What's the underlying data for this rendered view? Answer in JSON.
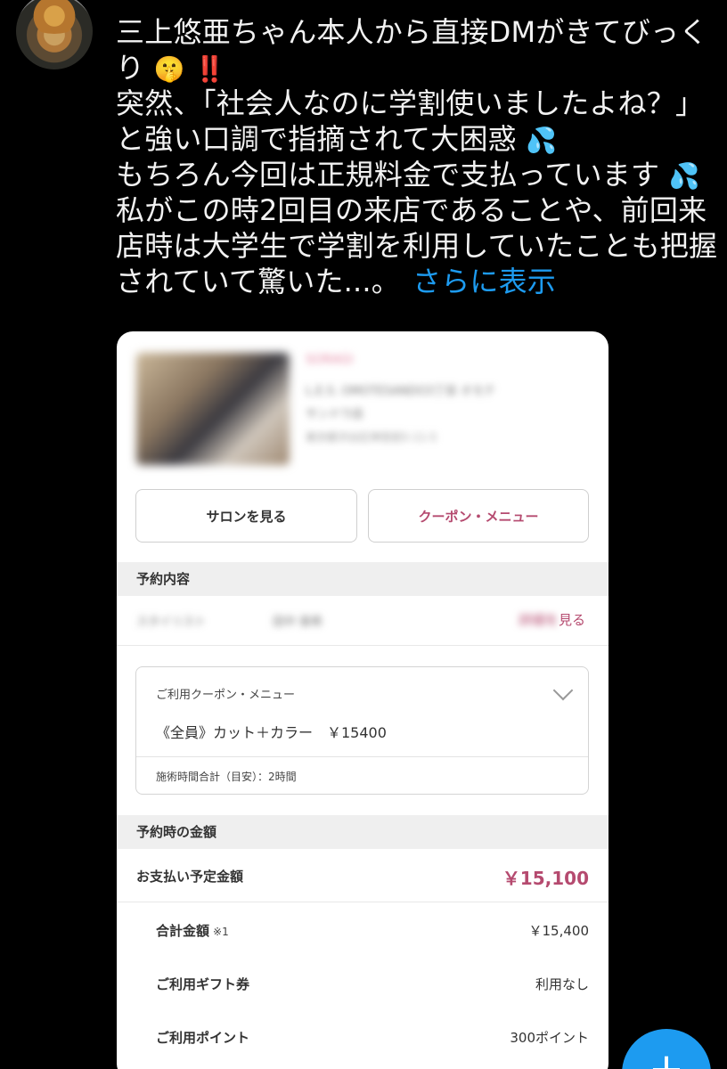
{
  "tweet": {
    "header_fragment": "",
    "lines": [
      "三上悠亜ちゃん本人から直接DMがきてびっく",
      "り",
      "突然、「社会人なのに学割使いましたよね？」",
      "と強い口調で指摘されて大困惑",
      "もちろん今回は正規料金で支払っています",
      "私がこの時2回目の来店であることや、前回来",
      "店時は大学生で学割を利用していたことも把握",
      "されていて驚いた...。"
    ],
    "emoji": {
      "shush": "🤫",
      "exclaim": "‼️",
      "sweat": "💦"
    },
    "more_link": "さらに表示"
  },
  "card": {
    "salon_name_blurred": "SORAGI",
    "address_line1_blurred": "L.E.S. OMOTESANDO3丁目 オモテ",
    "address_line2_blurred": "サンドウ店",
    "address_line3_blurred": "東京都渋谷区神宮前5-11-5",
    "buttons": {
      "salon": "サロンを見る",
      "coupon": "クーポン・メニュー"
    },
    "reservation_header": "予約内容",
    "stylist_blurred_1": "スタイリスト",
    "stylist_blurred_2": "田中 亜希",
    "detail_link_blurred": "詳細を",
    "detail_link": "見る",
    "coupon_box": {
      "label": "ご利用クーポン・メニュー",
      "item": "《全員》カット＋カラー　￥15400",
      "time": "施術時間合計（目安）：2時間"
    },
    "price_header": "予約時の金額",
    "rows": {
      "pay_label": "お支払い予定金額",
      "pay_value": "￥15,100",
      "total_label": "合計金額",
      "total_note": "※1",
      "total_value": "￥15,400",
      "gift_label": "ご利用ギフト券",
      "gift_value": "利用なし",
      "point_label": "ご利用ポイント",
      "point_value": "300ポイント"
    }
  },
  "fab": {
    "icon": "plus-icon",
    "symbol": "+"
  },
  "colors": {
    "link_blue": "#1d9bf0",
    "accent_pink": "#b54a6f",
    "background": "#000000",
    "card": "#ffffff"
  }
}
